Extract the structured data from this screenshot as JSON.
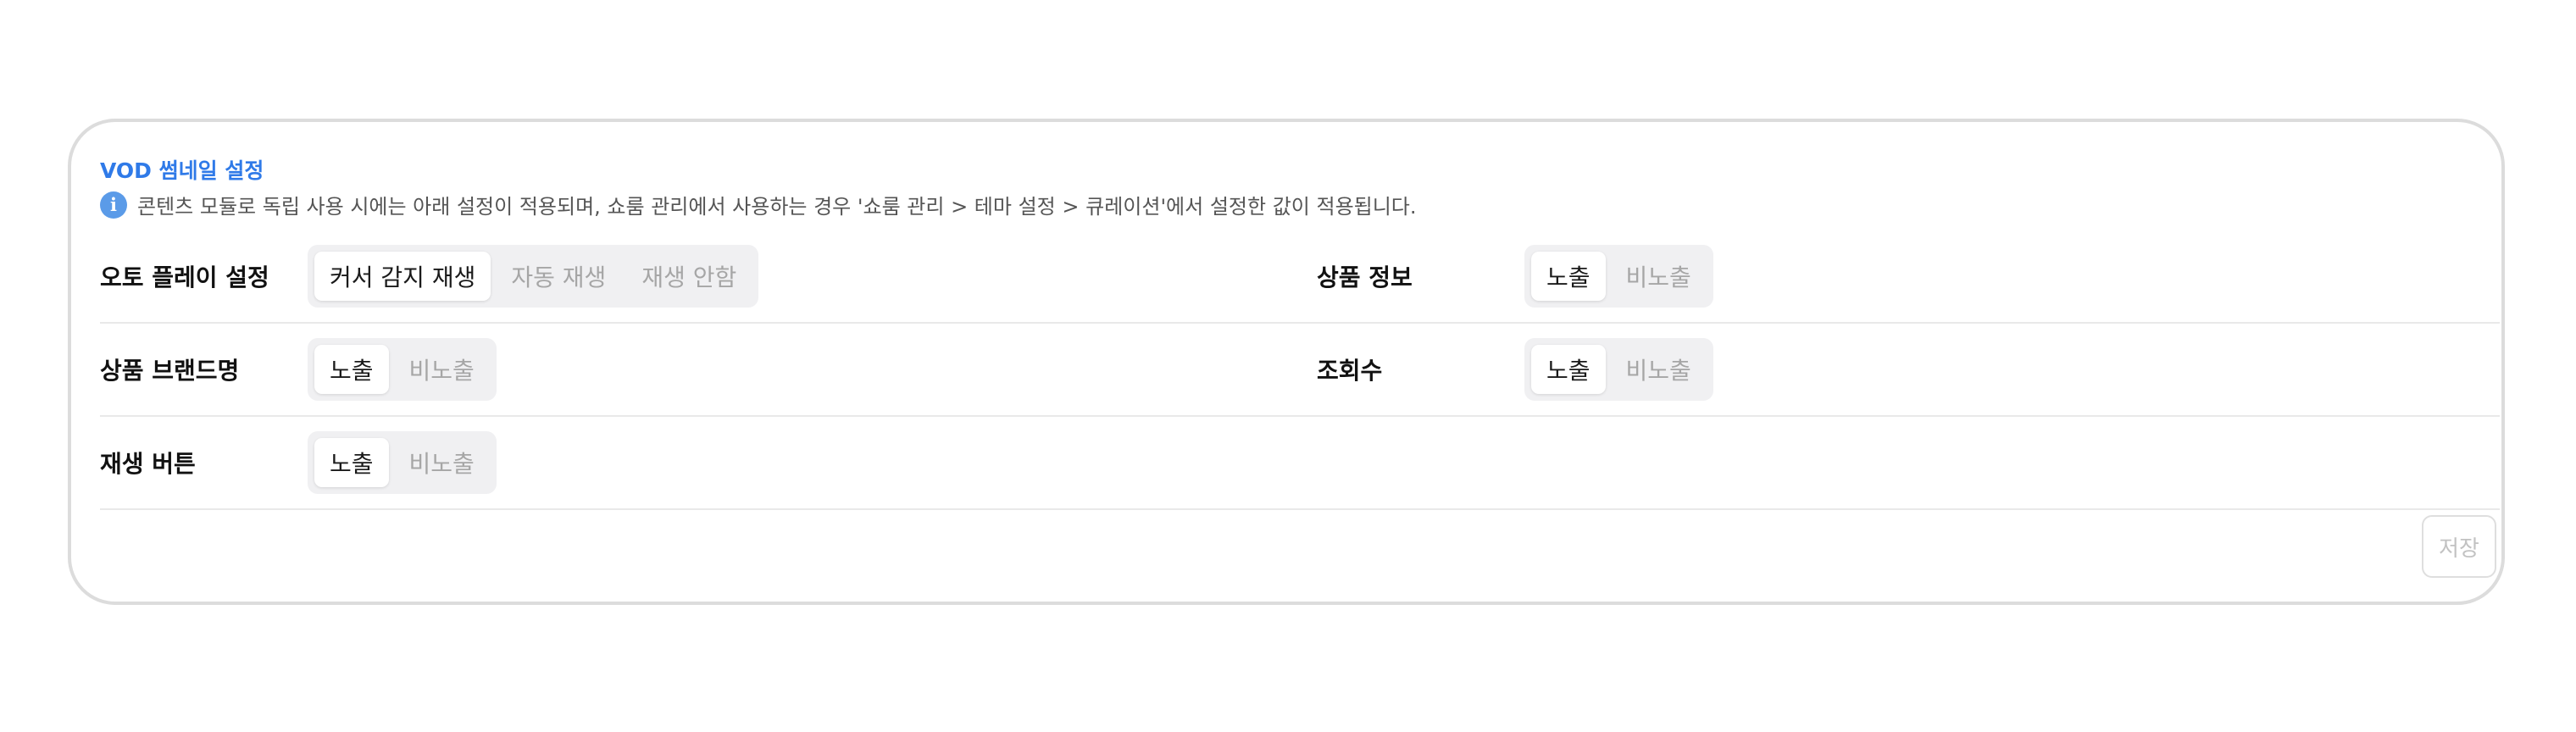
{
  "section": {
    "title": "VOD 썸네일 설정",
    "info_icon": "info-icon",
    "info_text": "콘텐츠 모듈로 독립 사용 시에는 아래 설정이 적용되며, 쇼룸 관리에서 사용하는 경우 '쇼룸 관리 > 테마 설정 > 큐레이션'에서 설정한 값이 적용됩니다."
  },
  "settings": {
    "autoplay": {
      "label": "오토 플레이 설정",
      "options": [
        "커서 감지 재생",
        "자동 재생",
        "재생 안함"
      ],
      "selected": "커서 감지 재생"
    },
    "product_info": {
      "label": "상품 정보",
      "options": [
        "노출",
        "비노출"
      ],
      "selected": "노출"
    },
    "brand_name": {
      "label": "상품 브랜드명",
      "options": [
        "노출",
        "비노출"
      ],
      "selected": "노출"
    },
    "view_count": {
      "label": "조회수",
      "options": [
        "노출",
        "비노출"
      ],
      "selected": "노출"
    },
    "play_button": {
      "label": "재생 버튼",
      "options": [
        "노출",
        "비노출"
      ],
      "selected": "노출"
    }
  },
  "actions": {
    "save_label": "저장"
  },
  "colors": {
    "accent": "#2f7ae8",
    "info_icon": "#5b9be8",
    "segment_bg": "#f0f0f2",
    "inactive_text": "#a6a6a6",
    "card_border": "#dcdcdc"
  }
}
